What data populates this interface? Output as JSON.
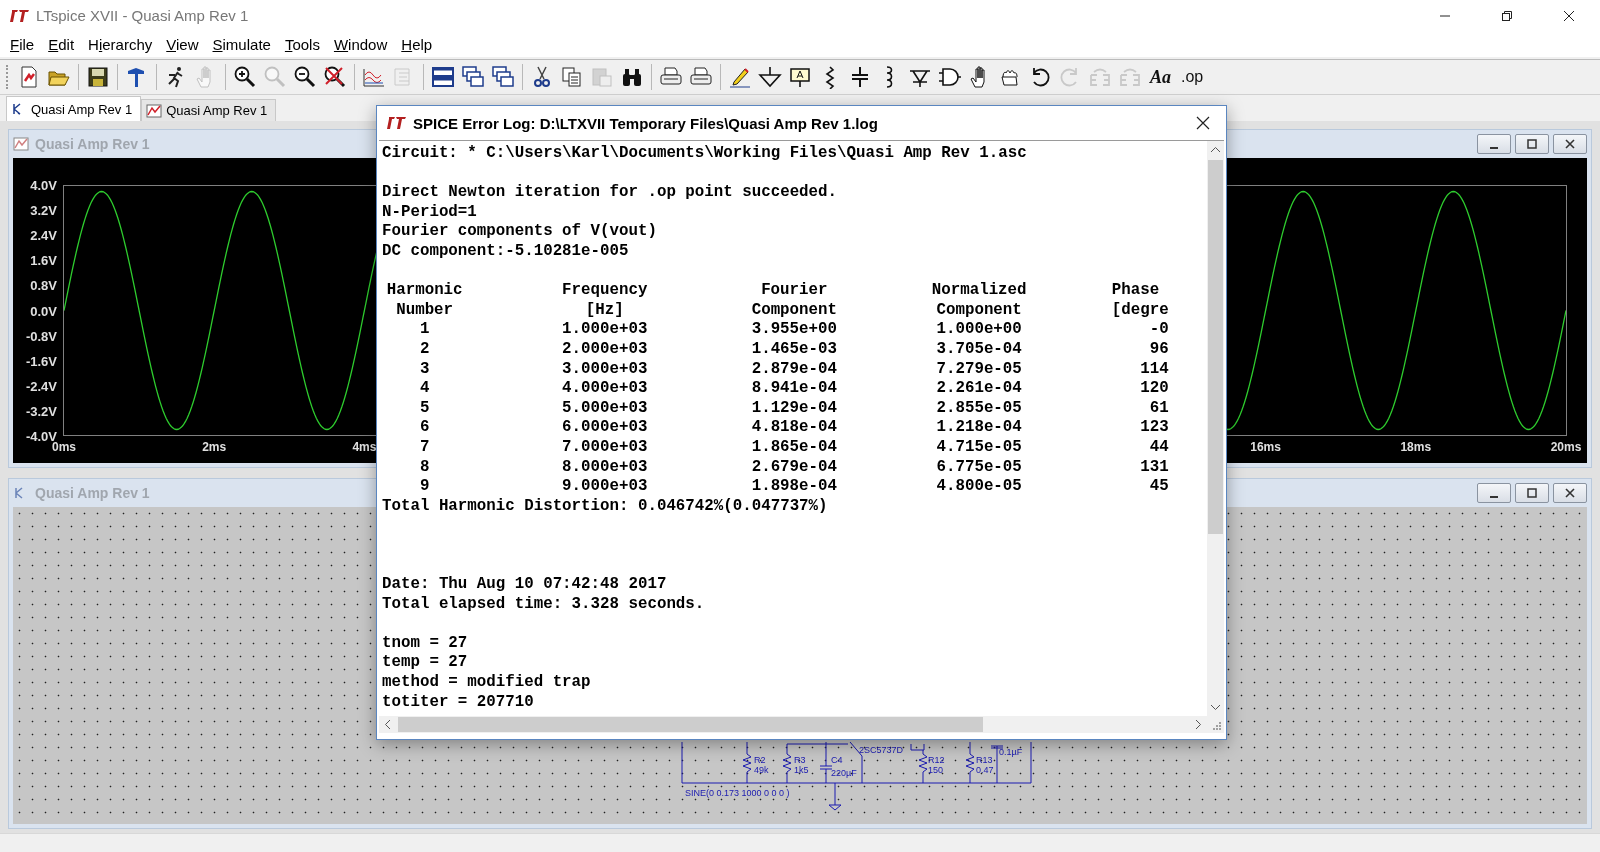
{
  "window": {
    "title": "LTspice XVII - Quasi Amp Rev 1"
  },
  "menu": [
    {
      "key": "F",
      "after": "ile"
    },
    {
      "key": "E",
      "after": "dit"
    },
    {
      "before": "H",
      "key": "i",
      "after": "erarchy"
    },
    {
      "key": "V",
      "after": "iew"
    },
    {
      "key": "S",
      "after": "imulate"
    },
    {
      "key": "T",
      "after": "ools"
    },
    {
      "key": "W",
      "after": "indow"
    },
    {
      "key": "H",
      "after": "elp"
    }
  ],
  "toolbar": [
    [
      {
        "kind": "new",
        "disabled": false
      },
      {
        "kind": "open",
        "disabled": false
      }
    ],
    [
      {
        "kind": "save",
        "disabled": false
      }
    ],
    [
      {
        "kind": "control-panel",
        "disabled": false
      }
    ],
    [
      {
        "kind": "run",
        "disabled": false
      },
      {
        "kind": "halt",
        "disabled": true
      }
    ],
    [
      {
        "kind": "zoom-in",
        "disabled": false
      },
      {
        "kind": "pan",
        "disabled": true
      },
      {
        "kind": "zoom-out",
        "disabled": false
      },
      {
        "kind": "zoom-cancel",
        "disabled": false
      }
    ],
    [
      {
        "kind": "autorange",
        "disabled": false
      },
      {
        "kind": "traces",
        "disabled": true
      }
    ],
    [
      {
        "kind": "tile-horizontal",
        "disabled": false
      },
      {
        "kind": "cascade",
        "disabled": false
      },
      {
        "kind": "tile-vertical",
        "disabled": false
      }
    ],
    [
      {
        "kind": "cut",
        "disabled": false
      },
      {
        "kind": "copy",
        "disabled": false
      },
      {
        "kind": "paste",
        "disabled": true
      },
      {
        "kind": "find",
        "disabled": false
      }
    ],
    [
      {
        "kind": "print-preview",
        "disabled": false
      },
      {
        "kind": "print",
        "disabled": false
      }
    ],
    [
      {
        "kind": "wire",
        "disabled": false
      },
      {
        "kind": "ground",
        "disabled": false
      },
      {
        "kind": "label",
        "disabled": false
      },
      {
        "kind": "resistor",
        "disabled": false
      },
      {
        "kind": "capacitor",
        "disabled": false
      },
      {
        "kind": "inductor",
        "disabled": false
      },
      {
        "kind": "diode",
        "disabled": false
      },
      {
        "kind": "component",
        "disabled": false
      },
      {
        "kind": "move",
        "disabled": false
      },
      {
        "kind": "drag",
        "disabled": false
      },
      {
        "kind": "undo",
        "disabled": false
      },
      {
        "kind": "redo",
        "disabled": true
      },
      {
        "kind": "rotate",
        "disabled": true
      },
      {
        "kind": "mirror",
        "disabled": true
      },
      {
        "kind": "text",
        "label": "Aa",
        "disabled": false
      },
      {
        "kind": "directive",
        "label": ".op",
        "disabled": false
      }
    ]
  ],
  "tabs": [
    {
      "kind": "schematic",
      "label": "Quasi Amp Rev 1",
      "selected": true
    },
    {
      "kind": "waveform",
      "label": "Quasi Amp Rev 1",
      "selected": false
    }
  ],
  "waveform_window": {
    "title": "Quasi Amp Rev 1",
    "y_ticks": [
      "4.0V",
      "3.2V",
      "2.4V",
      "1.6V",
      "0.8V",
      "0.0V",
      "-0.8V",
      "-1.6V",
      "-2.4V",
      "-3.2V",
      "-4.0V"
    ],
    "x_ticks_left": [
      "0ms",
      "2ms",
      "4ms"
    ],
    "x_ticks_right": [
      "16ms",
      "18ms",
      "20ms"
    ]
  },
  "schematic_window": {
    "title": "Quasi Amp Rev 1",
    "labels": {
      "r2": "R2",
      "r2_value": "49k",
      "r3": "R3",
      "r3_value": "1k5",
      "c4": "C4",
      "c4_value": "220µF",
      "transistor": "2SC5737D",
      "r12": "R12",
      "r12_value": "150",
      "r13": "R13",
      "r13_value": "0.47",
      "cap_value": "0.1µF",
      "source": "SINE(0 0.173 1000 0 0 0 )"
    }
  },
  "log_dialog": {
    "title": "SPICE Error Log: D:\\LTXVII Temporary Files\\Quasi Amp Rev 1.log",
    "sections": [
      {
        "kind": "header",
        "lines": [
          "Circuit: * C:\\Users\\Karl\\Documents\\Working Files\\Quasi Amp Rev 1.asc"
        ]
      },
      {
        "kind": "paragraph",
        "lines": [
          "Direct Newton iteration for .op point succeeded.",
          "N-Period=1",
          "Fourier components of V(vout)",
          "DC component:-5.10281e-005"
        ]
      },
      {
        "kind": "table",
        "columns": [
          {
            "title": "Harmonic",
            "subtitle": "Number"
          },
          {
            "title": "Frequency",
            "subtitle": "[Hz]"
          },
          {
            "title": "Fourier",
            "subtitle": "Component"
          },
          {
            "title": "Normalized",
            "subtitle": "Component"
          },
          {
            "title": "Phase",
            "subtitle": "[degre"
          }
        ],
        "rows": [
          [
            "1",
            "1.000e+03",
            "3.955e+00",
            "1.000e+00",
            "-0"
          ],
          [
            "2",
            "2.000e+03",
            "1.465e-03",
            "3.705e-04",
            "96"
          ],
          [
            "3",
            "3.000e+03",
            "2.879e-04",
            "7.279e-05",
            "114"
          ],
          [
            "4",
            "4.000e+03",
            "8.941e-04",
            "2.261e-04",
            "120"
          ],
          [
            "5",
            "5.000e+03",
            "1.129e-04",
            "2.855e-05",
            "61"
          ],
          [
            "6",
            "6.000e+03",
            "4.818e-04",
            "1.218e-04",
            "123"
          ],
          [
            "7",
            "7.000e+03",
            "1.865e-04",
            "4.715e-05",
            "44"
          ],
          [
            "8",
            "8.000e+03",
            "2.679e-04",
            "6.775e-05",
            "131"
          ],
          [
            "9",
            "9.000e+03",
            "1.898e-04",
            "4.800e-05",
            "45"
          ]
        ]
      },
      {
        "kind": "summary",
        "lines": [
          "Total Harmonic Distortion: 0.046742%(0.047737%)"
        ]
      },
      {
        "kind": "timing",
        "lines": [
          "Date: Thu Aug 10 07:42:48 2017",
          "Total elapsed time: 3.328 seconds."
        ]
      },
      {
        "kind": "paragraph",
        "lines": [
          "tnom = 27",
          "temp = 27",
          "method = modified trap",
          "totiter = 207710"
        ]
      }
    ]
  }
}
